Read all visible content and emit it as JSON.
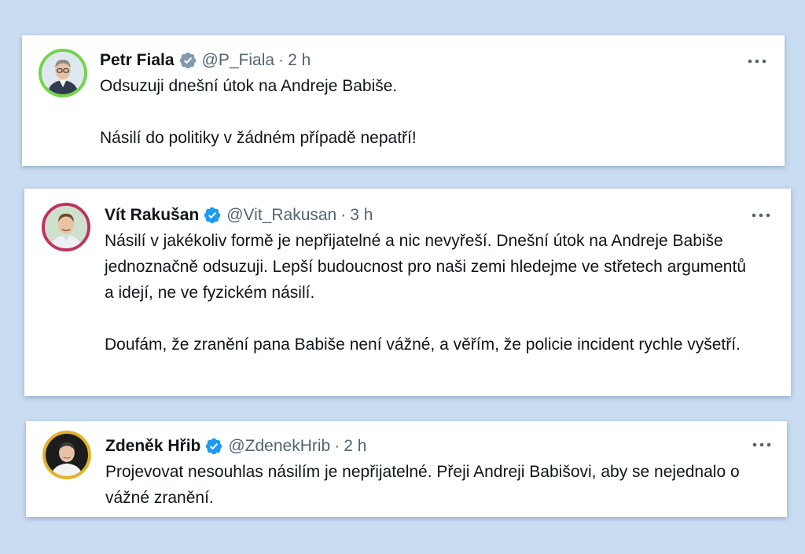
{
  "tweets": [
    {
      "name": "Petr Fiala",
      "verified_type": "gray-check",
      "handle": "@P_Fiala",
      "separator": "·",
      "time": "2 h",
      "paragraphs": [
        "Odsuzuji dnešní útok na Andreje Babiše.",
        "Násilí do politiky v žádném případě nepatří!"
      ],
      "avatar_ring_color": "#74d44a"
    },
    {
      "name": "Vít Rakušan",
      "verified_type": "blue-check",
      "handle": "@Vit_Rakusan",
      "separator": "·",
      "time": "3 h",
      "paragraphs": [
        "Násilí v jakékoliv formě je nepřijatelné a nic nevyřeší. Dnešní útok na Andreje Babiše jednoznačně odsuzuji. Lepší budoucnost pro naši zemi hledejme ve střetech argumentů a idejí, ne ve fyzickém násilí.",
        "Doufám, že zranění pana Babiše není vážné, a věřím, že policie incident rychle vyšetří."
      ],
      "avatar_ring_color": "#c0335e"
    },
    {
      "name": "Zdeněk Hřib",
      "verified_type": "blue-check",
      "handle": "@ZdenekHrib",
      "separator": "·",
      "time": "2 h",
      "paragraphs": [
        "Projevovat nesouhlas násilím je nepřijatelné. Přeji Andreji Babišovi, aby se nejednalo o vážné zranění."
      ],
      "avatar_ring_color": "#e3b22a"
    }
  ],
  "icons": {
    "verified": "verified-badge-icon",
    "more": "more-horizontal-icon"
  },
  "colors": {
    "background": "#c9dcf2",
    "card": "#ffffff",
    "text": "#0f1419",
    "secondary": "#536471",
    "verified_blue": "#1d9bf0",
    "verified_gray": "#829aab"
  }
}
